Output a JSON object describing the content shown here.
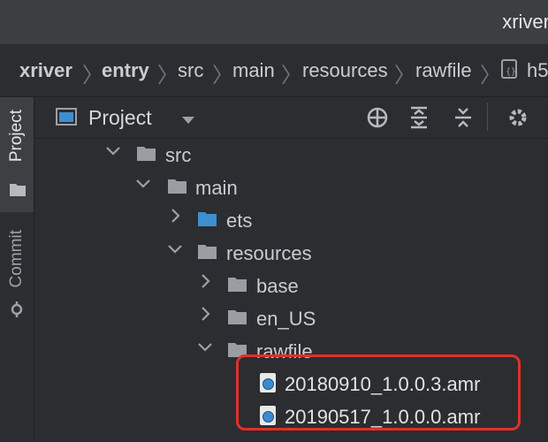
{
  "window": {
    "title": "xriver"
  },
  "breadcrumb": [
    "xriver",
    "entry",
    "src",
    "main",
    "resources",
    "rawfile",
    "h5"
  ],
  "tool_window": {
    "title": "Project",
    "left_tabs": [
      "Project",
      "Commit"
    ]
  },
  "tree": [
    {
      "label": "src",
      "type": "folder",
      "expanded": true
    },
    {
      "label": "main",
      "type": "folder",
      "expanded": true
    },
    {
      "label": "ets",
      "type": "source-folder",
      "expanded": false
    },
    {
      "label": "resources",
      "type": "folder",
      "expanded": true
    },
    {
      "label": "base",
      "type": "folder",
      "expanded": false
    },
    {
      "label": "en_US",
      "type": "folder",
      "expanded": false
    },
    {
      "label": "rawfile",
      "type": "folder",
      "expanded": true
    },
    {
      "label": "20180910_1.0.0.3.amr",
      "type": "audio-file"
    },
    {
      "label": "20190517_1.0.0.0.amr",
      "type": "audio-file"
    }
  ],
  "colors": {
    "highlight_border": "#e0302a",
    "source_folder": "#3d8fcf",
    "folder": "#9a9da3"
  }
}
